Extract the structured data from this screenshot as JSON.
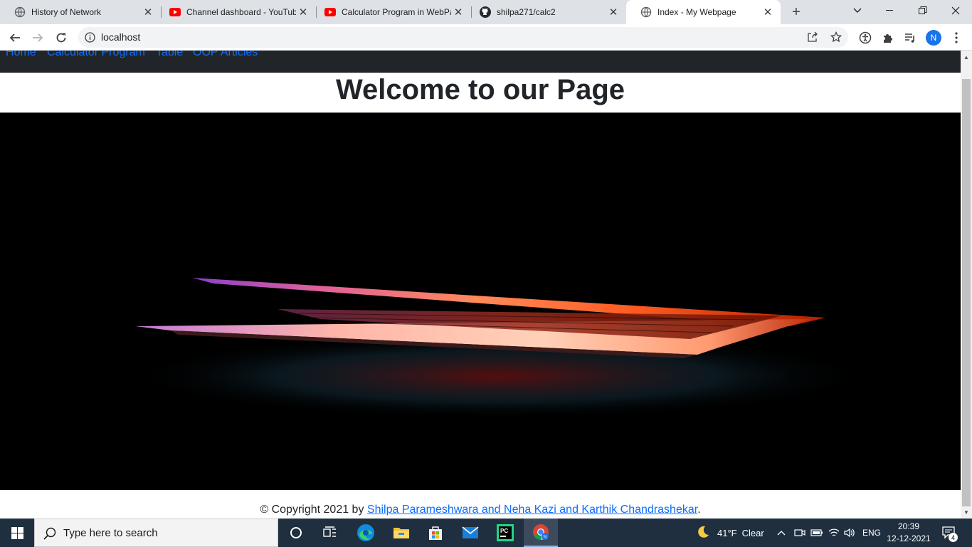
{
  "browser": {
    "tabs": [
      {
        "title": "History of Network",
        "icon": "globe-icon",
        "active": false
      },
      {
        "title": "Channel dashboard - YouTube",
        "icon": "youtube-icon",
        "active": false
      },
      {
        "title": "Calculator Program in WebPa",
        "icon": "youtube-icon",
        "active": false
      },
      {
        "title": "shilpa271/calc2",
        "icon": "github-icon",
        "active": false
      },
      {
        "title": "Index - My Webpage",
        "icon": "globe-icon",
        "active": true
      }
    ],
    "address": "localhost",
    "profile_initial": "N"
  },
  "page": {
    "nav": [
      "Home",
      "Calculator Program",
      "Table",
      "OOP Articles"
    ],
    "heading": "Welcome to our Page",
    "hero_image": "laptop glowing keyboard in dark",
    "footer": {
      "prefix": "© Copyright 2021 by ",
      "link": "Shilpa Parameshwara and Neha Kazi and Karthik Chandrashekar",
      "suffix": "."
    }
  },
  "taskbar": {
    "search_placeholder": "Type here to search",
    "weather": {
      "temp": "41°F",
      "condition": "Clear"
    },
    "language": "ENG",
    "time": "20:39",
    "date": "12-12-2021",
    "notifications": "4"
  },
  "colors": {
    "link": "#0d6efd",
    "navbar": "#212529",
    "taskbar": "#1f2f3f"
  }
}
